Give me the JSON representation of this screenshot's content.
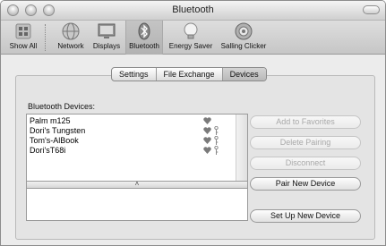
{
  "window": {
    "title": "Bluetooth"
  },
  "toolbar": {
    "items": [
      {
        "label": "Show All",
        "icon": "show-all-grid-icon"
      },
      {
        "label": "Network",
        "icon": "network-globe-icon"
      },
      {
        "label": "Displays",
        "icon": "displays-monitor-icon"
      },
      {
        "label": "Bluetooth",
        "icon": "bluetooth-icon",
        "selected": true
      },
      {
        "label": "Energy Saver",
        "icon": "lightbulb-icon"
      },
      {
        "label": "Salling Clicker",
        "icon": "salling-clicker-icon"
      }
    ]
  },
  "tabs": [
    {
      "label": "Settings"
    },
    {
      "label": "File Exchange"
    },
    {
      "label": "Devices",
      "active": true
    }
  ],
  "devices": {
    "label": "Bluetooth Devices:",
    "list": [
      {
        "name": "Palm m125",
        "favorite": true,
        "paired": false
      },
      {
        "name": "Dori's Tungsten",
        "favorite": true,
        "paired": true
      },
      {
        "name": "Tom's-AlBook",
        "favorite": true,
        "paired": true
      },
      {
        "name": "Dori'sT68i",
        "favorite": true,
        "paired": true
      }
    ],
    "splitter_glyph": "˄"
  },
  "buttons": {
    "add_favorites": "Add to Favorites",
    "delete_pairing": "Delete Pairing",
    "disconnect": "Disconnect",
    "pair_new": "Pair New Device",
    "setup_new": "Set Up New Device"
  },
  "colors": {
    "window_bg": "#ececec",
    "disabled_text": "#a8a8a8",
    "heart": "#7a7a7a"
  }
}
